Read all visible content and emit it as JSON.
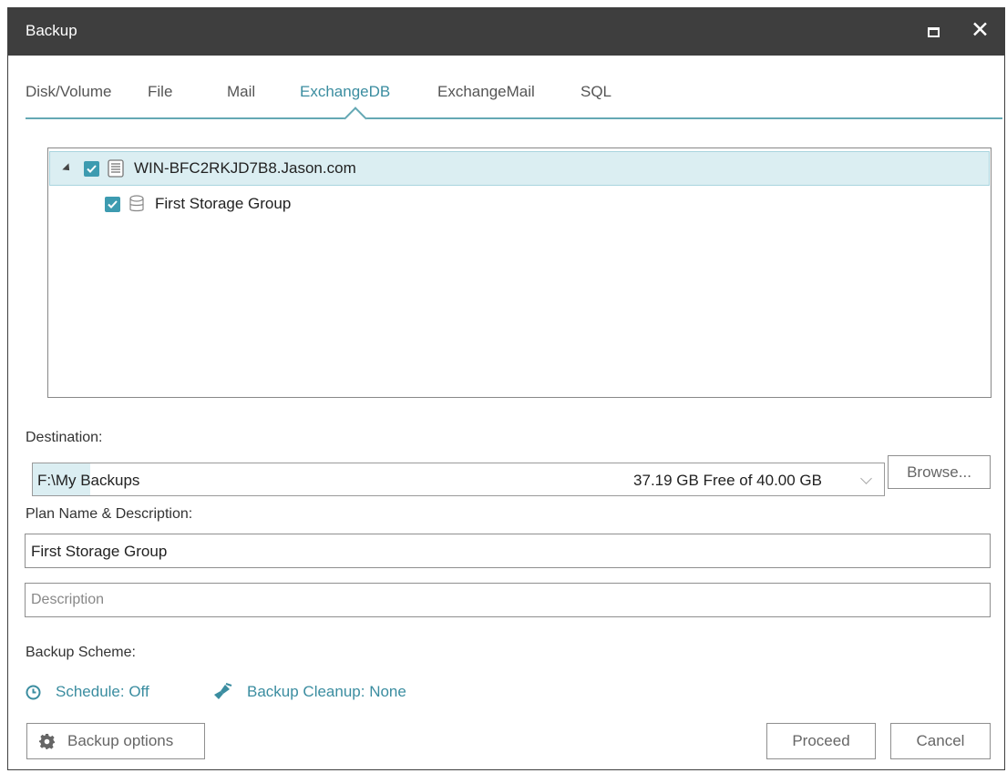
{
  "window": {
    "title": "Backup"
  },
  "titlebar": {
    "maximize_icon": "maximize-icon",
    "close_glyph": "✕"
  },
  "tabs": [
    {
      "label": "Disk/Volume"
    },
    {
      "label": "File"
    },
    {
      "label": "Mail"
    },
    {
      "label": "ExchangeDB",
      "active": true
    },
    {
      "label": "ExchangeMail"
    },
    {
      "label": "SQL"
    }
  ],
  "tree": {
    "root": {
      "label": "WIN-BFC2RKJD7B8.Jason.com",
      "checked": true,
      "expanded": true,
      "icon": "server-icon"
    },
    "children": [
      {
        "label": "First Storage Group",
        "checked": true,
        "icon": "database-icon"
      }
    ]
  },
  "destination": {
    "label": "Destination:",
    "path": "F:\\My Backups",
    "free_space": "37.19 GB Free of 40.00 GB",
    "browse_label": "Browse..."
  },
  "plan": {
    "label": "Plan Name & Description:",
    "name_value": "First Storage Group",
    "description_placeholder": "Description"
  },
  "scheme": {
    "label": "Backup Scheme:",
    "schedule": "Schedule: Off",
    "cleanup": "Backup Cleanup: None"
  },
  "footer": {
    "options_label": "Backup options",
    "proceed_label": "Proceed",
    "cancel_label": "Cancel"
  },
  "colors": {
    "accent": "#3b8da0",
    "titlebar": "#3e3e3e",
    "selection": "#dbeef2"
  }
}
